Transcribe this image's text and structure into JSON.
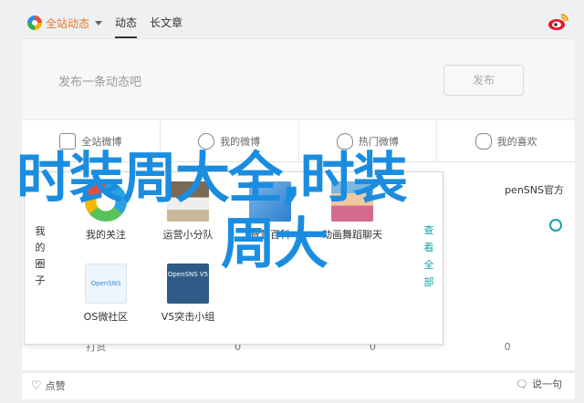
{
  "topbar": {
    "site_menu_label": "全站动态",
    "tabs": [
      {
        "label": "动态",
        "active": true
      },
      {
        "label": "长文章",
        "active": false
      }
    ]
  },
  "composer": {
    "placeholder": "发布一条动态吧",
    "post_label": "发布"
  },
  "categories": [
    {
      "label": "全站微博",
      "icon": "chat-icon"
    },
    {
      "label": "我的微博",
      "icon": "person-icon"
    },
    {
      "label": "热门微博",
      "icon": "fire-icon"
    },
    {
      "label": "我的喜欢",
      "icon": "heart-icon"
    }
  ],
  "feed": {
    "author": "penSNS官方",
    "actions": [
      "打赏",
      "0",
      "0",
      "0"
    ]
  },
  "popup": {
    "left_label": "我的圈子",
    "right_label": "查看全部",
    "tiles": [
      {
        "label": "我的关注"
      },
      {
        "label": "运营小分队"
      },
      {
        "label": "智慧百科"
      },
      {
        "label": "动画舞蹈聊天"
      },
      {
        "label": "OS微社区",
        "thumb_text": "OpenSNS"
      },
      {
        "label": "V5突击小组",
        "thumb_text": "OpenSNS V5"
      }
    ]
  },
  "footer": {
    "like_label": "点赞",
    "say_label": "说一句"
  },
  "headline": {
    "line1": "时装周大全,时装",
    "line2": "周大"
  },
  "colors": {
    "accent": "#1aa2a0",
    "headline": "#1a8de0",
    "site_menu": "#e8792a"
  }
}
